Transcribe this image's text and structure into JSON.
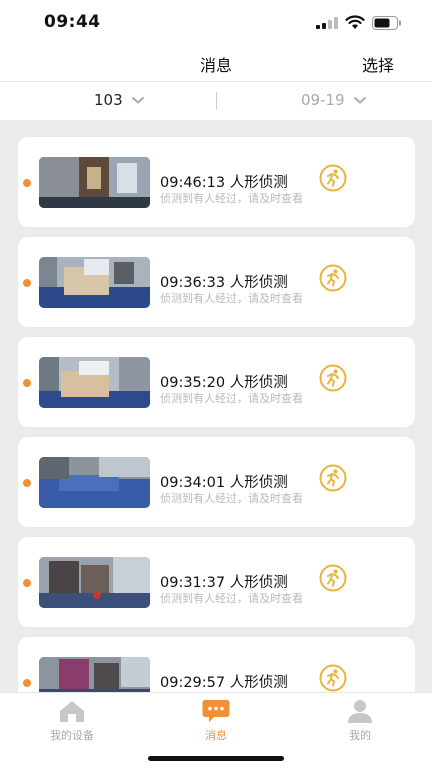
{
  "status_bar": {
    "time": "09:44"
  },
  "nav": {
    "title": "消息",
    "select_label": "选择"
  },
  "filters": {
    "device": "103",
    "date": "09-19"
  },
  "colors": {
    "accent": "#f0913a",
    "icon_yellow": "#e9b33b",
    "tab_active": "#e9953f"
  },
  "messages": [
    {
      "title": "09:46:13 人形侦测",
      "desc": "侦测到有人经过，请及时查看",
      "icon": "running-person-icon"
    },
    {
      "title": "09:36:33 人形侦测",
      "desc": "侦测到有人经过，请及时查看",
      "icon": "running-person-icon"
    },
    {
      "title": "09:35:20 人形侦测",
      "desc": "侦测到有人经过，请及时查看",
      "icon": "running-person-icon"
    },
    {
      "title": "09:34:01 人形侦测",
      "desc": "侦测到有人经过，请及时查看",
      "icon": "running-person-icon"
    },
    {
      "title": "09:31:37 人形侦测",
      "desc": "侦测到有人经过，请及时查看",
      "icon": "running-person-icon"
    },
    {
      "title": "09:29:57 人形侦测",
      "desc": "",
      "icon": "running-person-icon"
    }
  ],
  "tabs": [
    {
      "label": "我的设备",
      "icon": "home-icon",
      "active": false
    },
    {
      "label": "消息",
      "icon": "chat-icon",
      "active": true
    },
    {
      "label": "我的",
      "icon": "user-icon",
      "active": false
    }
  ]
}
